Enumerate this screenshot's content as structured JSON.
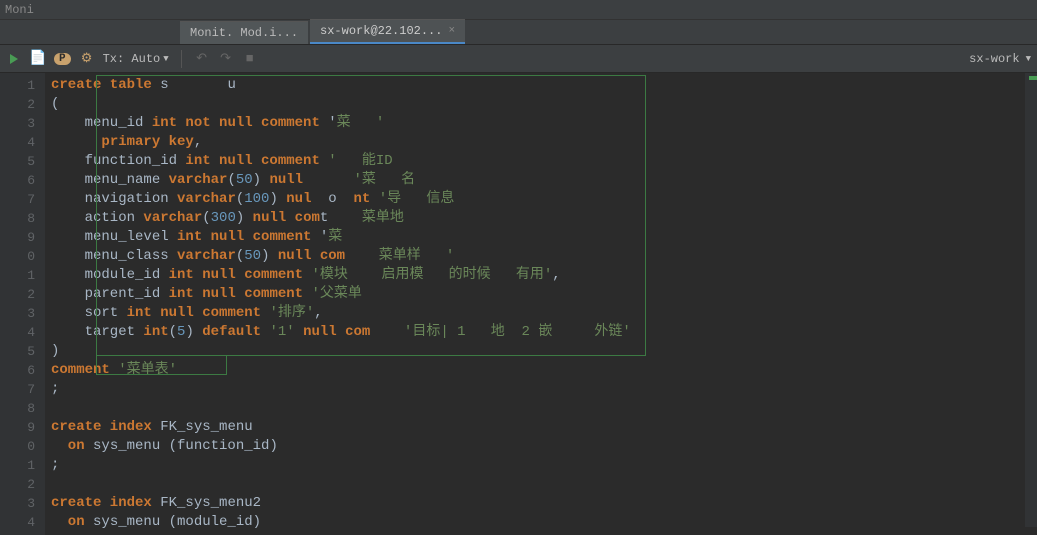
{
  "topbar": {
    "left": "Moni"
  },
  "tabs": [
    {
      "label": "Monit. Mod.i...",
      "active": false
    },
    {
      "label": "sx-work@22.102...",
      "active": true
    }
  ],
  "toolbar": {
    "tx": "Tx: Auto",
    "right": "sx-work"
  },
  "gutter": [
    "1",
    "2",
    "3",
    "4",
    "5",
    "6",
    "7",
    "8",
    "9",
    "0",
    "1",
    "2",
    "3",
    "4",
    "5",
    "6",
    "7",
    "8",
    "9",
    "0",
    "1",
    "2",
    "3",
    "4"
  ],
  "code": {
    "l1_pre": "create table",
    "l1_s": " s",
    "l1_u": "u",
    "l2": "(",
    "l3_a": "    menu_id ",
    "l3_b": "int not null comment",
    "l3_c": " '",
    "l3_d": "菜",
    "l3_e": "'",
    "l4_a": "      ",
    "l4_b": "primary key",
    "l4_c": ",",
    "l5_a": "    function_id ",
    "l5_b": "int null comment",
    "l5_c": " '   ",
    "l5_d": "能ID",
    "l6_a": "    menu_name ",
    "l6_b": "varchar",
    "l6_c": "(",
    "l6_d": "50",
    "l6_e": ") ",
    "l6_f": "null",
    "l6_g": " ",
    "l6_h": "   ",
    "l6_i": "  ",
    "l6_j": "'菜   名",
    "l7_a": "    navigation ",
    "l7_b": "varchar",
    "l7_c": "(",
    "l7_d": "100",
    "l7_e": ") ",
    "l7_f": "nul",
    "l7_g": "  o  ",
    "l7_h": "nt",
    "l7_i": " '导   信息",
    "l8_a": "    action ",
    "l8_b": "varchar",
    "l8_c": "(",
    "l8_d": "300",
    "l8_e": ") ",
    "l8_f": "null com",
    "l8_g": "t",
    "l8_h": "    菜单地",
    "l9_a": "    menu_level ",
    "l9_b": "int null comment",
    "l9_c": " '",
    "l9_d": "菜",
    "l10_a": "    menu_class ",
    "l10_b": "varchar",
    "l10_c": "(",
    "l10_d": "50",
    "l10_e": ") ",
    "l10_f": "null com",
    "l10_g": "   ",
    "l10_h": " 菜单样   '",
    "l11_a": "    module_id ",
    "l11_b": "int null comment",
    "l11_c": " '模块    启用模   的时候   有用'",
    "l11_d": ",",
    "l12_a": "    parent_id ",
    "l12_b": "int null comment",
    "l12_c": " '父菜单",
    "l13_a": "    sort ",
    "l13_b": "int null comment",
    "l13_c": " '排序'",
    "l13_d": ",",
    "l14_a": "    target ",
    "l14_b": "int",
    "l14_c": "(",
    "l14_d": "5",
    "l14_e": ") ",
    "l14_f": "default",
    "l14_g": " '1' ",
    "l14_h": "null com",
    "l14_i": "    '目标| 1   地  2 嵌     外链'",
    "l15": ")",
    "l16_a": "comment",
    "l16_b": " '菜单表'",
    "l17": ";",
    "l19_a": "create index",
    "l19_b": " FK_sys_menu",
    "l20_a": "  on",
    "l20_b": " sys_menu (function_id)",
    "l21": ";",
    "l23_a": "create index",
    "l23_b": " FK_sys_menu2",
    "l24_a": "  on",
    "l24_b": " sys_menu (module_id)"
  }
}
